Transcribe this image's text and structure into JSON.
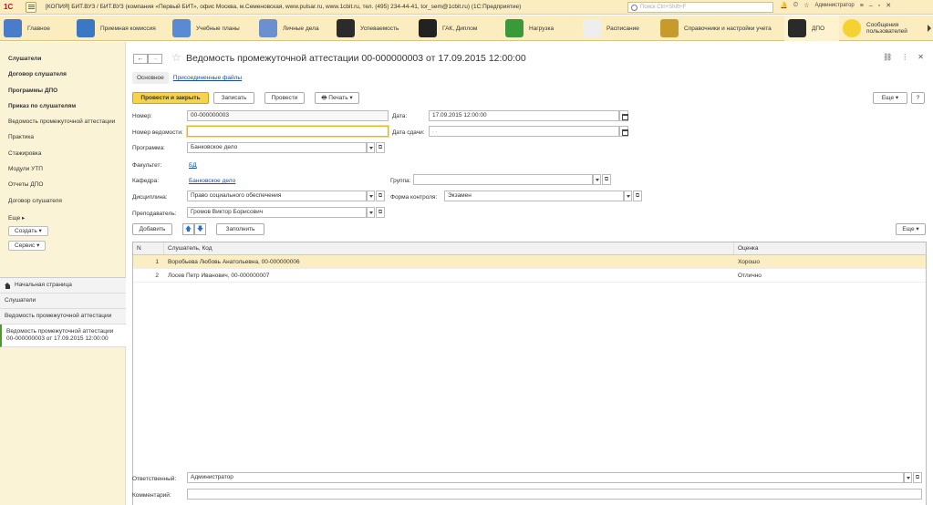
{
  "titlebar": {
    "logo": "1С",
    "title": "[КОПИЯ] БИТ.ВУЗ / БИТ.ВУЗ (компания «Первый БИТ», офис Москва, м.Семеновская, www.pulsar.ru, www.1cbit.ru, тел. (495) 234-44-41, tor_sem@1cbit.ru) (1С:Предприятие)",
    "search_placeholder": "Поиск Ctrl+Shift+F",
    "user": "Администратор"
  },
  "sections": [
    {
      "label": "Главное",
      "color": "#4a7dc9"
    },
    {
      "label": "Приемная комиссия",
      "color": "#3b78c3"
    },
    {
      "label": "Учебные планы",
      "color": "#5a8ad4"
    },
    {
      "label": "Личные дела",
      "color": "#6b8fcf"
    },
    {
      "label": "Успеваемость",
      "color": "#2b2b2b"
    },
    {
      "label": "ГАК, Диплом",
      "color": "#222222"
    },
    {
      "label": "Нагрузка",
      "color": "#3a9a3a"
    },
    {
      "label": "Расписание",
      "color": "#eeeeee"
    },
    {
      "label": "Справочники и настройки учета",
      "color": "#c69b2c"
    },
    {
      "label": "ДПО",
      "color": "#2a2a2a"
    },
    {
      "label": "Сообщения пользователей",
      "color": "#f5d232"
    }
  ],
  "leftnav": {
    "items": [
      {
        "label": "Слушатели",
        "bold": true
      },
      {
        "label": "Договор слушателя",
        "bold": true
      },
      {
        "label": "Программы ДПО",
        "bold": true
      },
      {
        "label": "Приказ по слушателям",
        "bold": true
      },
      {
        "label": "Ведомость промежуточной аттестации",
        "bold": false
      },
      {
        "label": "Практика",
        "bold": false
      },
      {
        "label": "Стажировка",
        "bold": false
      },
      {
        "label": "Модули УТП",
        "bold": false
      },
      {
        "label": "Отчеты ДПО",
        "bold": false
      },
      {
        "label": "Договор слушателя",
        "bold": false
      }
    ],
    "more": "Еще",
    "create": "Создать",
    "service": "Сервис"
  },
  "open_windows": {
    "home": "Начальная страница",
    "items": [
      "Слушатели",
      "Ведомость промежуточной аттестации",
      "Ведомость промежуточной аттестации 00-000000003 от 17.09.2015 12:00:00"
    ]
  },
  "form": {
    "title": "Ведомость промежуточной аттестации 00-000000003 от 17.09.2015 12:00:00",
    "tabs": {
      "main": "Основное",
      "files": "Присоединенные файлы"
    },
    "buttons": {
      "post_close": "Провести и закрыть",
      "save": "Записать",
      "post": "Провести",
      "print": "Печать",
      "more": "Еще",
      "help": "?",
      "add": "Добавить",
      "fill": "Заполнить",
      "more_table": "Еще"
    },
    "fields": {
      "number_label": "Номер:",
      "number": "00-000000003",
      "date_label": "Дата:",
      "date": "17.09.2015 12:00:00",
      "sheet_label": "Номер ведомости:",
      "sheet": "",
      "deliver_label": "Дата сдачи:",
      "deliver": " .  .",
      "program_label": "Программа:",
      "program": "Банковское дело",
      "faculty_label": "Факультет:",
      "faculty": "БД",
      "dept_label": "Кафедра:",
      "dept": "Банковское дело",
      "group_label": "Группа:",
      "group": "",
      "discipline_label": "Дисциплина:",
      "discipline": "Право социального обеспечения",
      "control_label": "Форма контроля:",
      "control": "Экзамен",
      "teacher_label": "Преподаватель:",
      "teacher": "Громов Виктор Борисович",
      "responsible_label": "Ответственный:",
      "responsible": "Администратор",
      "comment_label": "Комментарий:",
      "comment": ""
    },
    "table": {
      "columns": [
        "N",
        "Слушатель, Код",
        "Оценка"
      ],
      "rows": [
        {
          "n": "1",
          "student": "Воробьева Любовь Анатольевна, 00-000000006",
          "grade": "Хорошо"
        },
        {
          "n": "2",
          "student": "Лосев Петр Иванович, 00-000000007",
          "grade": "Отлично"
        }
      ]
    }
  }
}
